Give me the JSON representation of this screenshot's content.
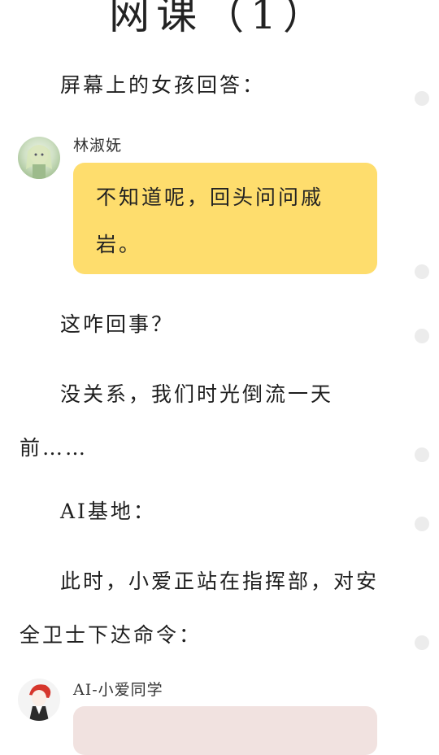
{
  "title": "网课（1）",
  "paragraphs": {
    "p1": "屏幕上的女孩回答：",
    "p2": "这咋回事？",
    "p3": "没关系，我们时光倒流一天前……",
    "p4": "AI基地：",
    "p5": "此时，小爱正站在指挥部，对安全卫士下达命令："
  },
  "messages": [
    {
      "speaker": "林淑妩",
      "text": "不知道呢，回头问问戚岩。",
      "bubble_color": "#fedd6d"
    },
    {
      "speaker": "AI-小爱同学",
      "text": "",
      "bubble_color": "#f1e2e0"
    }
  ],
  "colors": {
    "dot": "#ececec",
    "text": "#1e1e1e"
  }
}
